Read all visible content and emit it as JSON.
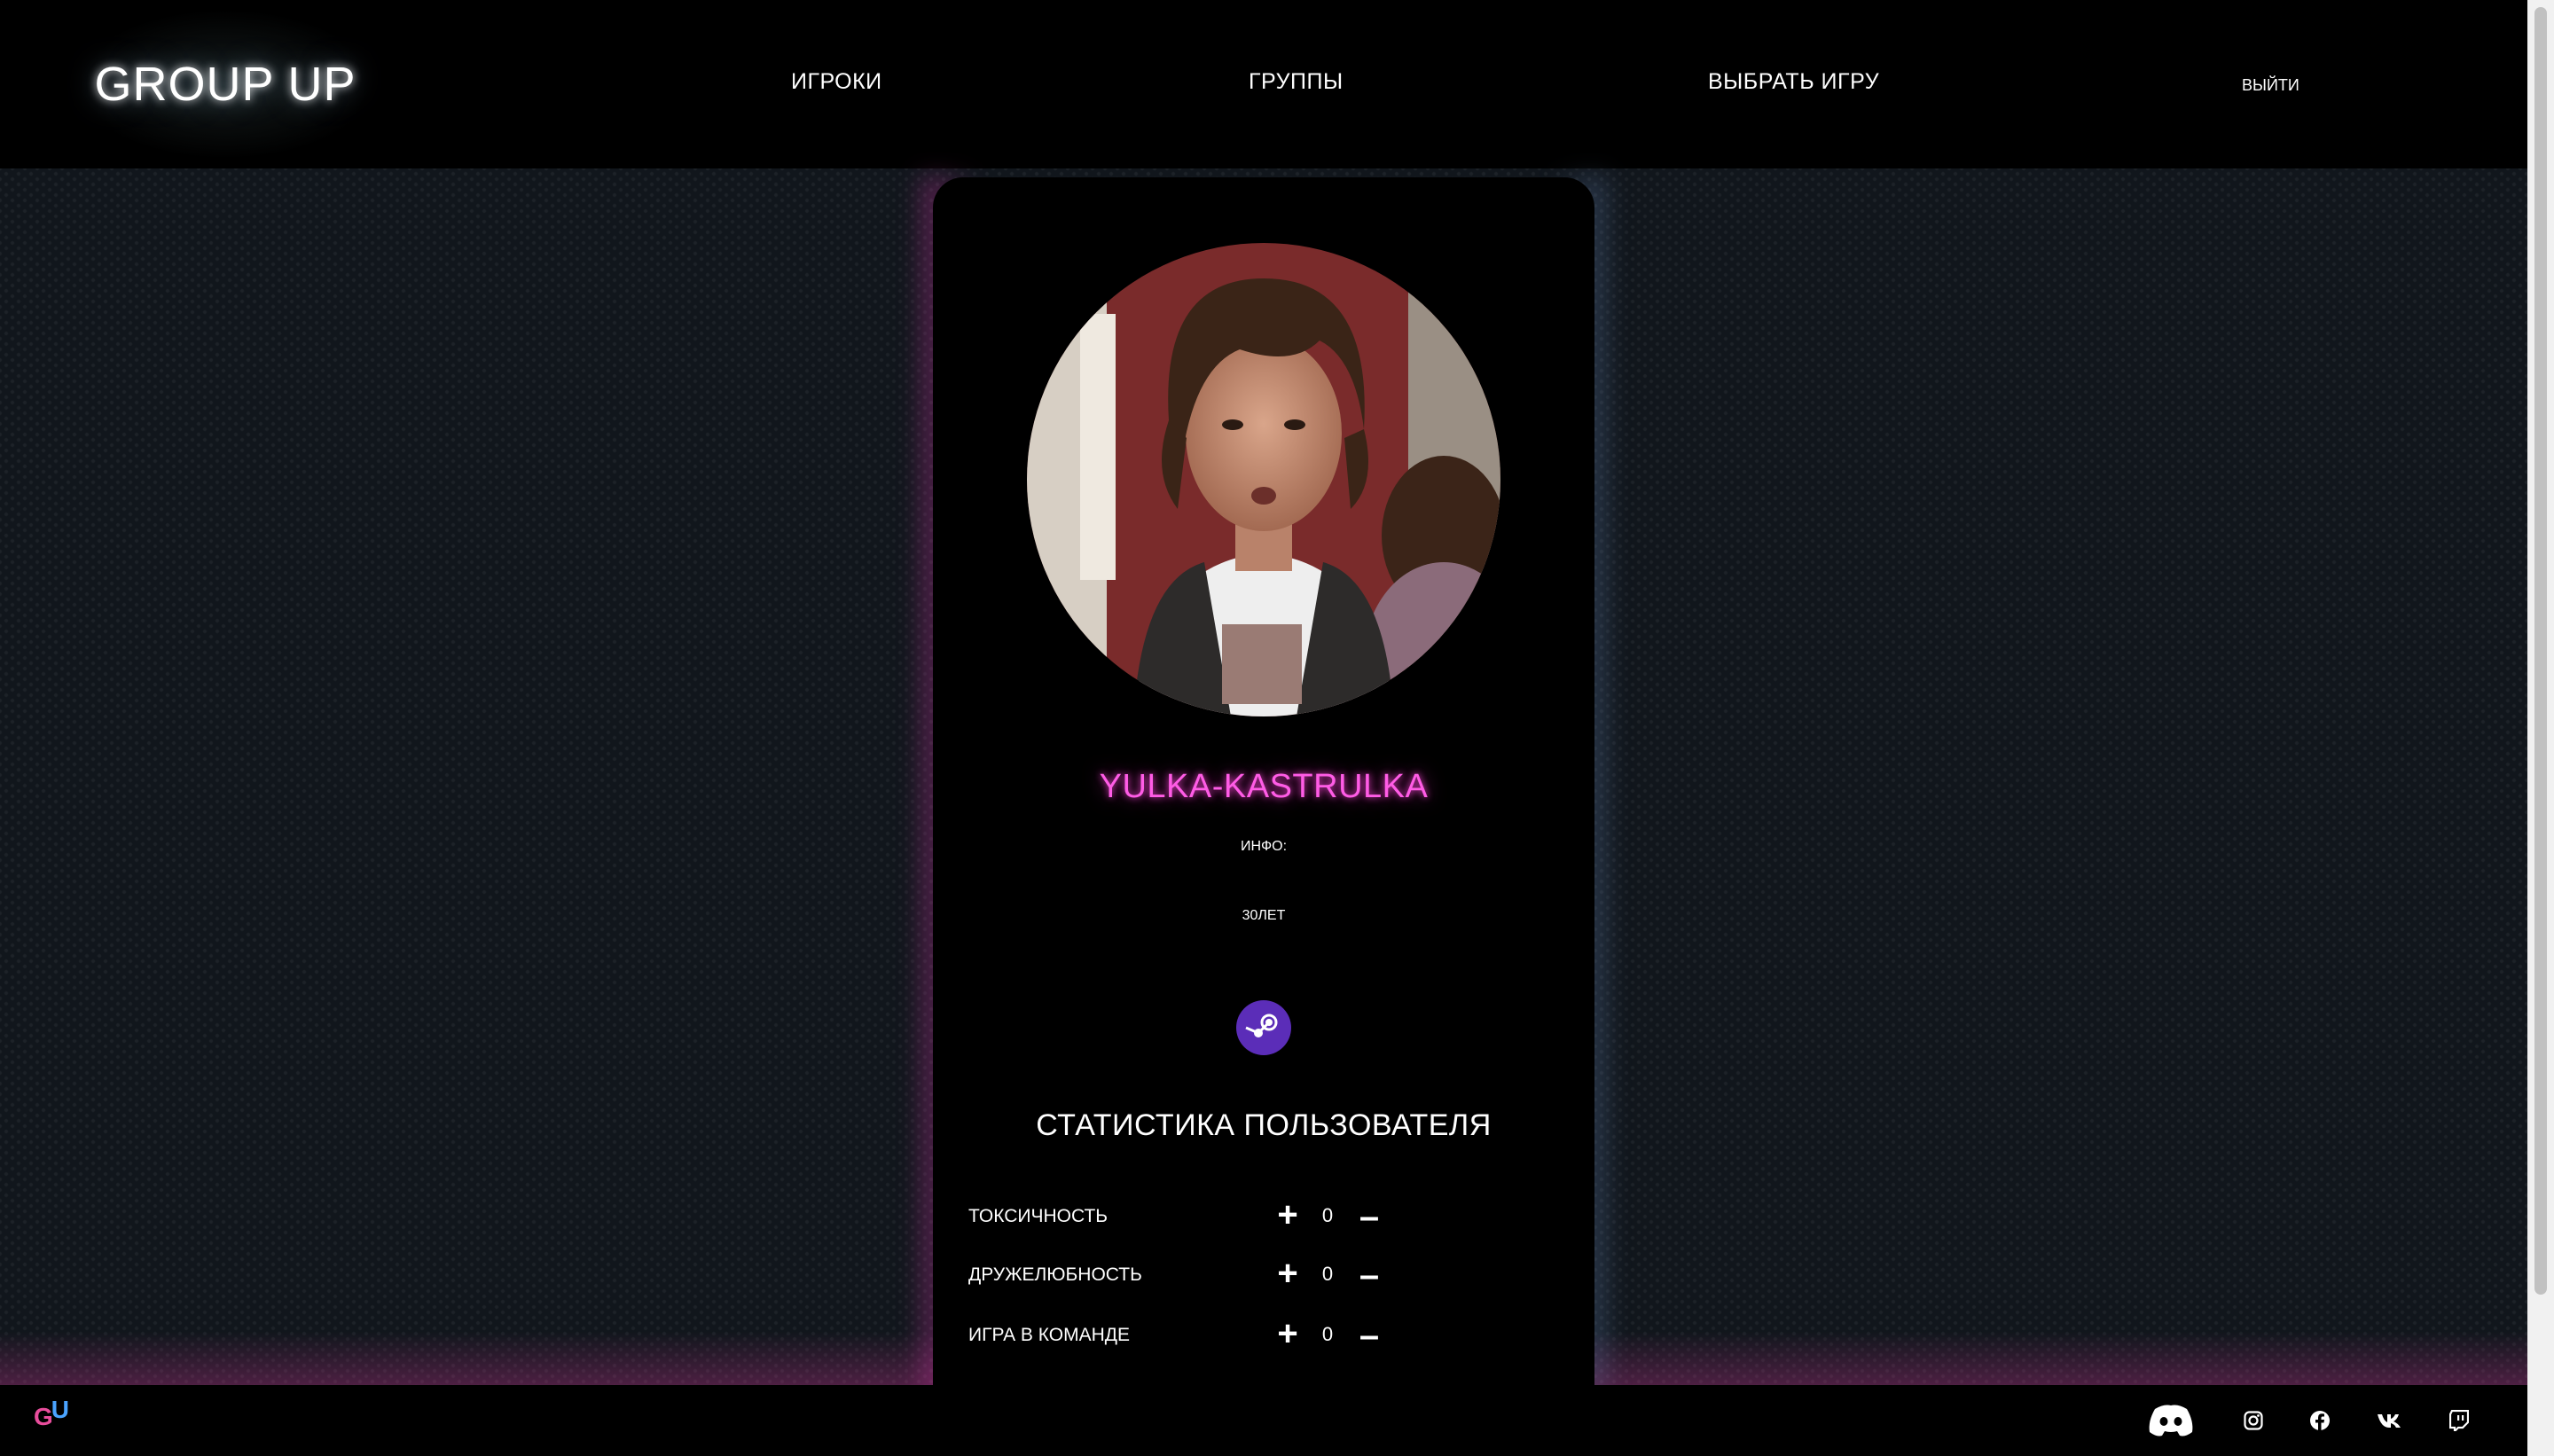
{
  "header": {
    "logo": "GROUP UP",
    "nav": [
      {
        "label": "ИГРОКИ"
      },
      {
        "label": "ГРУППЫ"
      },
      {
        "label": "ВЫБРАТЬ ИГРУ"
      }
    ],
    "logout": "ВЫЙТИ"
  },
  "profile": {
    "username": "YULKA-KASTRULKA",
    "info_label": "ИНФО:",
    "age": "30ЛЕТ",
    "steam_icon": "steam-icon"
  },
  "stats": {
    "title": "СТАТИСТИКА ПОЛЬЗОВАТЕЛЯ",
    "rows": [
      {
        "label": "ТОКСИЧНОСТЬ",
        "value": "0"
      },
      {
        "label": "ДРУЖЕЛЮБНОСТЬ",
        "value": "0"
      },
      {
        "label": "ИГРА В КОМАНДЕ",
        "value": "0"
      }
    ],
    "plus": "+",
    "minus": "–"
  },
  "footer": {
    "logo_g": "G",
    "logo_u": "U",
    "social": [
      "discord-icon",
      "instagram-icon",
      "facebook-icon",
      "vk-icon",
      "twitch-icon"
    ]
  },
  "colors": {
    "accent_pink": "#ff5ce6",
    "steam_purple": "#5b2db8",
    "background": "#11161c"
  }
}
